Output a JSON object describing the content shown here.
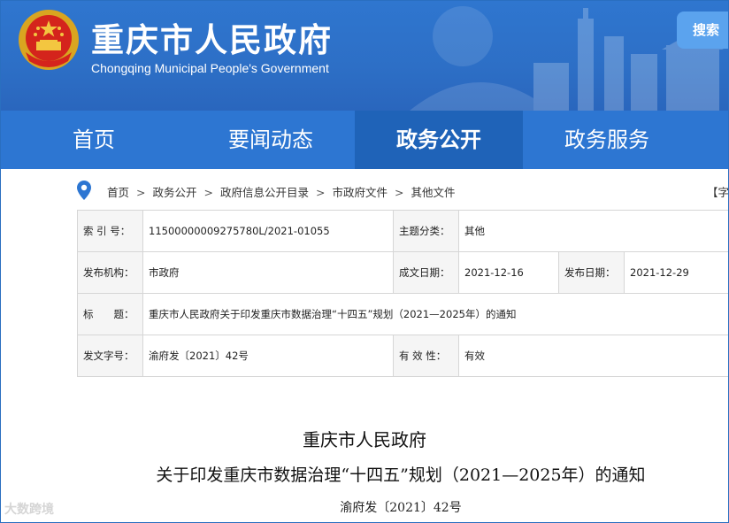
{
  "header": {
    "title": "重庆市人民政府",
    "subtitle": "Chongqing Municipal People's Government",
    "search_label": "搜索",
    "brand_color": "#2d76d2"
  },
  "nav": {
    "items": [
      {
        "label": "首页",
        "active": false
      },
      {
        "label": "要闻动态",
        "active": false
      },
      {
        "label": "政务公开",
        "active": true
      },
      {
        "label": "政务服务",
        "active": false
      }
    ]
  },
  "breadcrumb": {
    "items": [
      "首页",
      "政务公开",
      "政府信息公开目录",
      "市政府文件",
      "其他文件"
    ],
    "separator": ">",
    "font_control": "【字"
  },
  "info": {
    "index_label": "索 引 号：",
    "index_value": "11500000009275780L/2021-01055",
    "topic_label": "主题分类：",
    "topic_value": "其他",
    "issuer_label": "发布机构：",
    "issuer_value": "市政府",
    "created_label": "成文日期：",
    "created_value": "2021-12-16",
    "published_label": "发布日期：",
    "published_value": "2021-12-29",
    "title_label": "标　　题：",
    "title_value": "重庆市人民政府关于印发重庆市数据治理“十四五”规划（2021—2025年）的通知",
    "docno_label": "发文字号：",
    "docno_value": "渝府发〔2021〕42号",
    "validity_label": "有 效 性：",
    "validity_value": "有效"
  },
  "document": {
    "org": "重庆市人民政府",
    "title": "关于印发重庆市数据治理“十四五”规划（2021—2025年）的通知",
    "number": "渝府发〔2021〕42号"
  },
  "watermark": "大数跨境"
}
